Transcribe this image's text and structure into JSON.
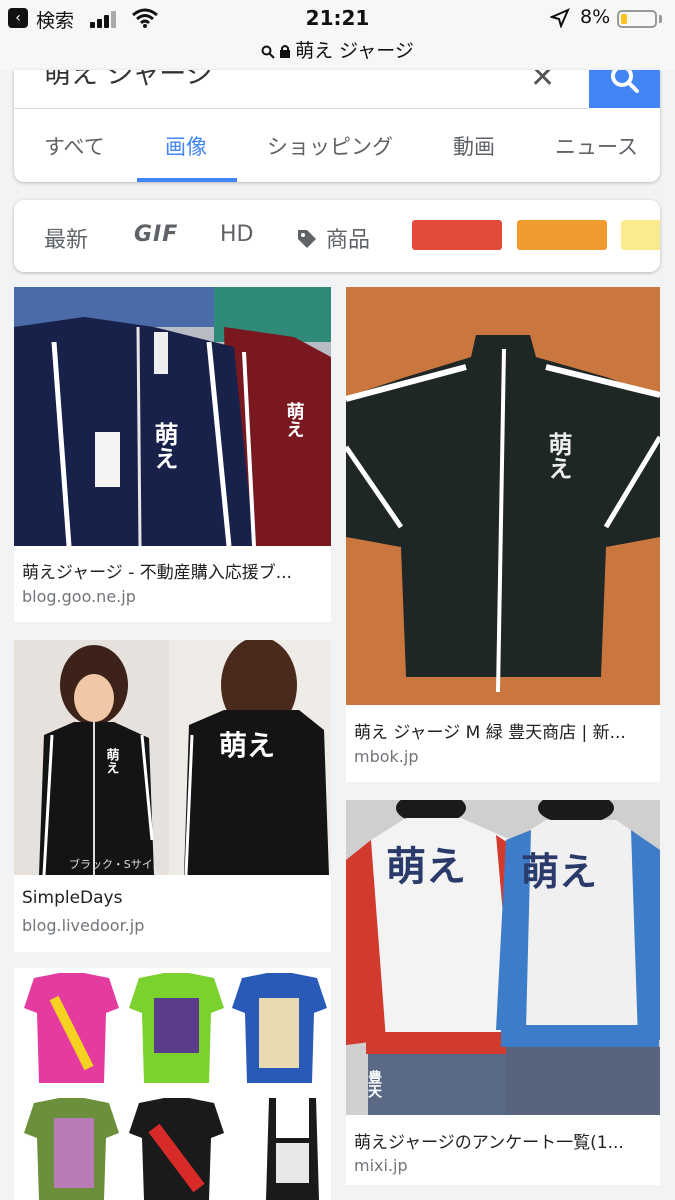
{
  "status": {
    "back_label": "検索",
    "time": "21:21",
    "battery_pct": "8%",
    "battery_level": 0.08,
    "url": "萌え ジャージ"
  },
  "search": {
    "query": "萌え ジャージ",
    "clear_icon": "close-icon",
    "search_icon": "search-icon",
    "accent": "#4285f4"
  },
  "tabs": [
    {
      "label": "すべて",
      "active": false
    },
    {
      "label": "画像",
      "active": true
    },
    {
      "label": "ショッピング",
      "active": false
    },
    {
      "label": "動画",
      "active": false
    },
    {
      "label": "ニュース",
      "active": false
    }
  ],
  "filters": {
    "latest": "最新",
    "gif": "GIF",
    "hd": "HD",
    "product": "商品",
    "colors": [
      "#e24b3b",
      "#f09a30",
      "#faec8e"
    ]
  },
  "results": [
    {
      "title": "萌えジャージ - 不動産購入応援ブ...",
      "source": "blog.goo.ne.jp"
    },
    {
      "title": "萌え ジャージ M 緑 豊天商店 | 新...",
      "source": "mbok.jp"
    },
    {
      "title": "SimpleDays",
      "source": "blog.livedoor.jp"
    },
    {
      "title": "萌えジャージのアンケート一覧(1...",
      "source": "mixi.jp"
    }
  ],
  "image_text": {
    "moe": "萌え",
    "caption_black": "ブラック・Sサイズ",
    "toyoten": "豊天"
  }
}
